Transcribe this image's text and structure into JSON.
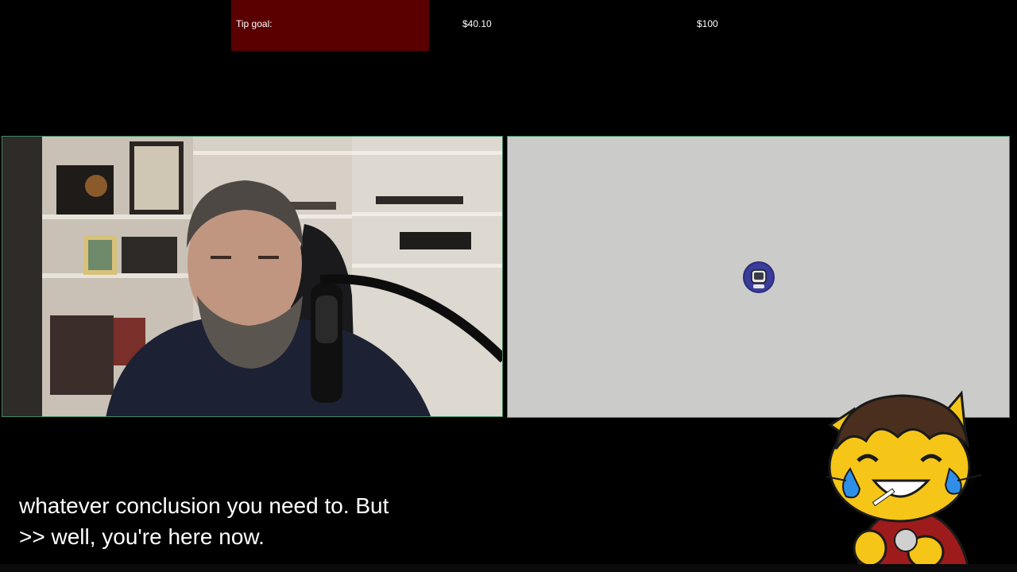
{
  "tip_goal": {
    "label": "Tip goal:",
    "current": "$40.10",
    "target": "$100",
    "progress_fraction": 0.401,
    "fill_color": "#5a0000"
  },
  "webcam": {
    "border_color": "#3f8a64"
  },
  "screen_share": {
    "background_color": "#cbcbca",
    "avatar_icon": "astronaut-avatar-icon"
  },
  "captions": {
    "lines": [
      "whatever conclusion you need to. But",
      ">> well, you're here now."
    ]
  },
  "mascot": {
    "icon": "crying-laughing-cat-mascot"
  }
}
